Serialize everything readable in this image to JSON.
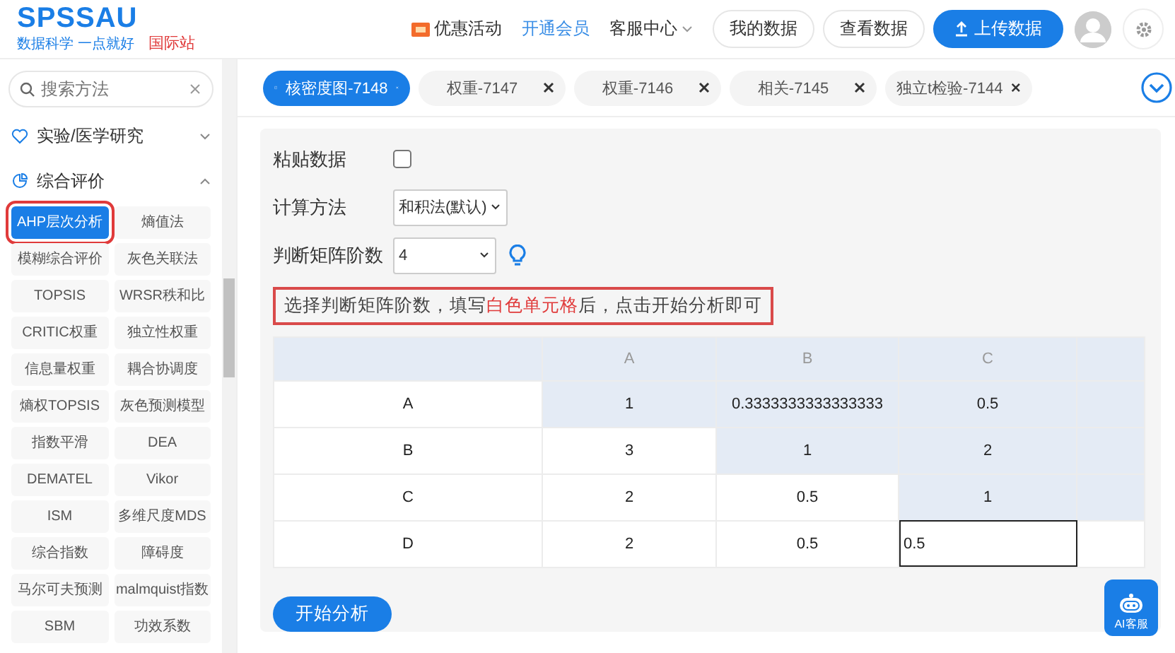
{
  "header": {
    "logo": "SPSSAU",
    "tagline": "数据科学 一点就好",
    "site_badge": "国际站",
    "nav": [
      {
        "label": "优惠活动",
        "kind": "promo"
      },
      {
        "label": "开通会员",
        "kind": "link"
      },
      {
        "label": "客服中心",
        "kind": "menu"
      }
    ],
    "buttons": [
      {
        "label": "我的数据",
        "kind": "plain"
      },
      {
        "label": "查看数据",
        "kind": "plain"
      },
      {
        "label": "上传数据",
        "kind": "primary"
      }
    ]
  },
  "sidebar": {
    "search": {
      "placeholder": "搜索方法"
    },
    "categories": [
      {
        "label": "实验/医学研究",
        "expanded": false
      },
      {
        "label": "综合评价",
        "expanded": true,
        "items": [
          {
            "label": "AHP层次分析",
            "selected": true
          },
          {
            "label": "熵值法",
            "selected": false
          },
          {
            "label": "模糊综合评价",
            "selected": false
          },
          {
            "label": "灰色关联法",
            "selected": false
          },
          {
            "label": "TOPSIS",
            "selected": false
          },
          {
            "label": "WRSR秩和比",
            "selected": false
          },
          {
            "label": "CRITIC权重",
            "selected": false
          },
          {
            "label": "独立性权重",
            "selected": false
          },
          {
            "label": "信息量权重",
            "selected": false
          },
          {
            "label": "耦合协调度",
            "selected": false
          },
          {
            "label": "熵权TOPSIS",
            "selected": false
          },
          {
            "label": "灰色预测模型",
            "selected": false
          },
          {
            "label": "指数平滑",
            "selected": false
          },
          {
            "label": "DEA",
            "selected": false
          },
          {
            "label": "DEMATEL",
            "selected": false
          },
          {
            "label": "Vikor",
            "selected": false
          },
          {
            "label": "ISM",
            "selected": false
          },
          {
            "label": "多维尺度MDS",
            "selected": false
          },
          {
            "label": "综合指数",
            "selected": false
          },
          {
            "label": "障碍度",
            "selected": false
          },
          {
            "label": "马尔可夫预测",
            "selected": false
          },
          {
            "label": "malmquist指数",
            "selected": false
          },
          {
            "label": "SBM",
            "selected": false
          },
          {
            "label": "功效系数",
            "selected": false
          }
        ]
      }
    ]
  },
  "tabs": [
    {
      "label": "核密度图-7148",
      "selected": true
    },
    {
      "label": "权重-7147",
      "selected": false
    },
    {
      "label": "权重-7146",
      "selected": false
    },
    {
      "label": "相关-7145",
      "selected": false
    },
    {
      "label": "独立t检验-7144",
      "selected": false
    }
  ],
  "form": {
    "paste": {
      "label": "粘贴数据",
      "checked": false
    },
    "method": {
      "label": "计算方法",
      "value": "和积法(默认)"
    },
    "order": {
      "label": "判断矩阵阶数",
      "value": "4"
    },
    "notice": {
      "before": "选择判断矩阵阶数，填写",
      "highlight": "白色单元格",
      "after": "后，点击开始分析即可"
    }
  },
  "matrix": {
    "columns": [
      "A",
      "B",
      "C"
    ],
    "rows": [
      {
        "label": "A",
        "cells": [
          {
            "value": "1",
            "readonly": true
          },
          {
            "value": "0.3333333333333333",
            "readonly": true
          },
          {
            "value": "0.5",
            "readonly": true
          },
          {
            "readonly": true
          }
        ]
      },
      {
        "label": "B",
        "cells": [
          {
            "value": "3",
            "readonly": false
          },
          {
            "value": "1",
            "readonly": true
          },
          {
            "value": "2",
            "readonly": true
          },
          {
            "readonly": true
          }
        ]
      },
      {
        "label": "C",
        "cells": [
          {
            "value": "2",
            "readonly": false
          },
          {
            "value": "0.5",
            "readonly": false
          },
          {
            "value": "1",
            "readonly": true
          },
          {
            "readonly": true
          }
        ]
      },
      {
        "label": "D",
        "cells": [
          {
            "value": "2",
            "readonly": false
          },
          {
            "value": "0.5",
            "readonly": false
          },
          {
            "value": "0.5",
            "readonly": false,
            "editing": true
          },
          {
            "readonly": false
          }
        ]
      }
    ]
  },
  "start_button": "开始分析",
  "assistant": "AI客服"
}
